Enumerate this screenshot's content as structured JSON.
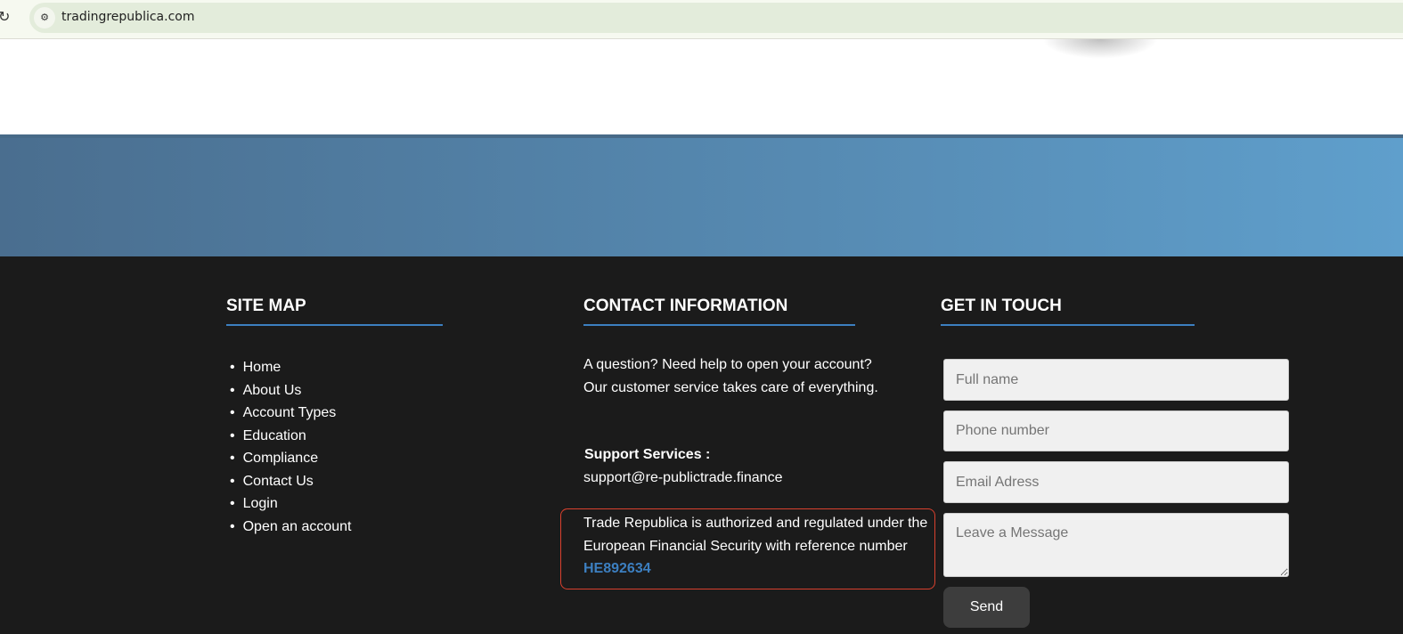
{
  "browser": {
    "url": "tradingrepublica.com"
  },
  "sitemap": {
    "title": "SITE MAP",
    "items": [
      "Home",
      "About Us",
      "Account Types",
      "Education",
      "Compliance",
      "Contact Us",
      "Login",
      "Open an account"
    ]
  },
  "contact": {
    "title": "CONTACT INFORMATION",
    "line1": "A question? Need help to open your account?",
    "line2": "Our customer service takes care of everything.",
    "support_label": "Support Services :",
    "support_email": "support@re-publictrade.finance",
    "reg_line1": "Trade Republica is authorized and regulated under the",
    "reg_line2": "European Financial Security with reference number",
    "reg_number": "HE892634"
  },
  "form": {
    "title": "GET IN TOUCH",
    "name_placeholder": "Full name",
    "phone_placeholder": "Phone number",
    "email_placeholder": "Email Adress",
    "message_placeholder": "Leave a Message",
    "send_label": "Send"
  },
  "colors": {
    "accent": "#3c7fc0",
    "footer_bg": "#1b1b1b",
    "highlight_border": "#d9412e"
  }
}
